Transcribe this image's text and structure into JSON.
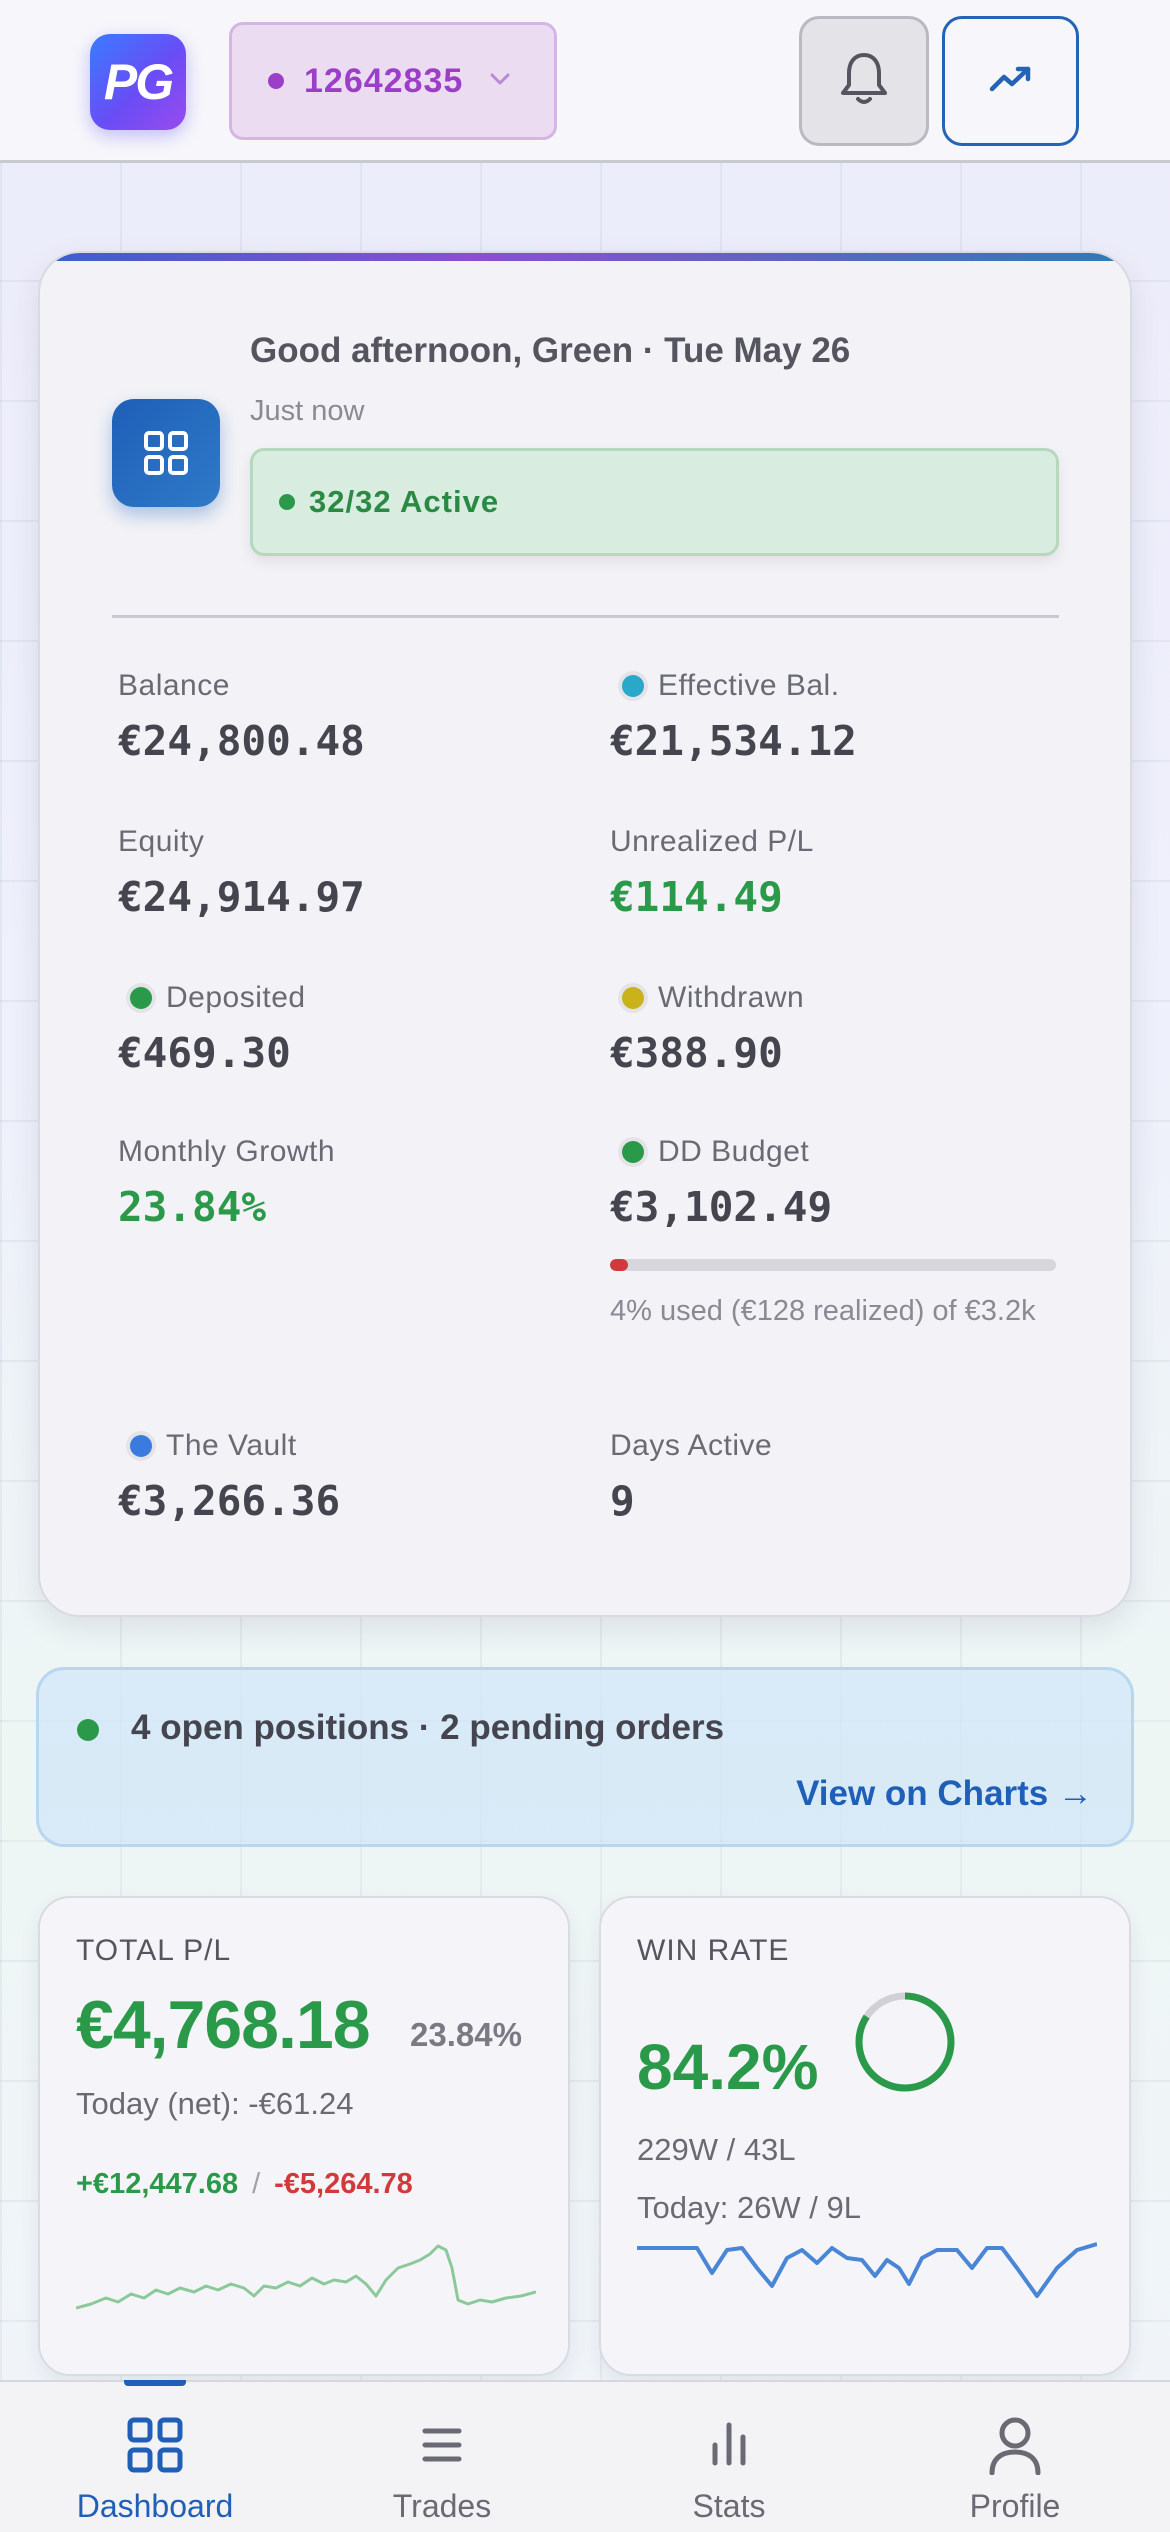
{
  "header": {
    "logo_text": "PG",
    "account_id": "12642835",
    "account_color": "#9b3fc9",
    "icons": [
      "bell-icon",
      "trending-up-icon",
      "chevron-down-icon"
    ]
  },
  "summary": {
    "greeting": "Good afternoon, Green · Tue May 26",
    "updated": "Just now",
    "active_status": "32/32 Active",
    "stats": {
      "balance": {
        "label": "Balance",
        "value": "€24,800.48"
      },
      "effective_balance": {
        "label": "Effective Bal.",
        "value": "€21,534.12",
        "dot_color": "#2aa8c9"
      },
      "equity": {
        "label": "Equity",
        "value": "€24,914.97"
      },
      "unrealized": {
        "label": "Unrealized P/L",
        "value": "€114.49"
      },
      "deposited": {
        "label": "Deposited",
        "value": "€469.30",
        "dot_color": "#2a9a4a"
      },
      "withdrawn": {
        "label": "Withdrawn",
        "value": "€388.90",
        "dot_color": "#c9b21a"
      },
      "monthly_growth": {
        "label": "Monthly Growth",
        "value": "23.84%"
      },
      "dd_budget": {
        "label": "DD Budget",
        "value": "€3,102.49",
        "dot_color": "#2a9a4a",
        "used_fraction": 0.04,
        "note": "4% used (€128 realized) of €3.2k"
      },
      "vault": {
        "label": "The Vault",
        "value": "€3,266.36",
        "dot_color": "#3b7be0"
      },
      "days_active": {
        "label": "Days Active",
        "value": "9"
      }
    }
  },
  "positions": {
    "text": "4 open positions · 2 pending orders",
    "link": "View on Charts →"
  },
  "total_pl": {
    "title": "TOTAL P/L",
    "value": "€4,768.18",
    "pct": "23.84%",
    "today": "Today (net): -€61.24",
    "gains": "+€12,447.68",
    "separator": "/",
    "losses": "-€5,264.78",
    "spark_color": "#8cc99a"
  },
  "win_rate": {
    "title": "WIN RATE",
    "value": "84.2%",
    "fraction": 0.842,
    "record": "229W / 43L",
    "today": "Today: 26W / 9L",
    "spark_color": "#4a86d6"
  },
  "nav": {
    "items": [
      {
        "label": "Dashboard",
        "icon": "grid-icon",
        "active": true
      },
      {
        "label": "Trades",
        "icon": "list-icon",
        "active": false
      },
      {
        "label": "Stats",
        "icon": "bar-chart-icon",
        "active": false
      },
      {
        "label": "Profile",
        "icon": "user-icon",
        "active": false
      }
    ]
  },
  "colors": {
    "accent": "#1f5fb8",
    "positive": "#2a9a4a",
    "negative": "#d13a3a"
  }
}
